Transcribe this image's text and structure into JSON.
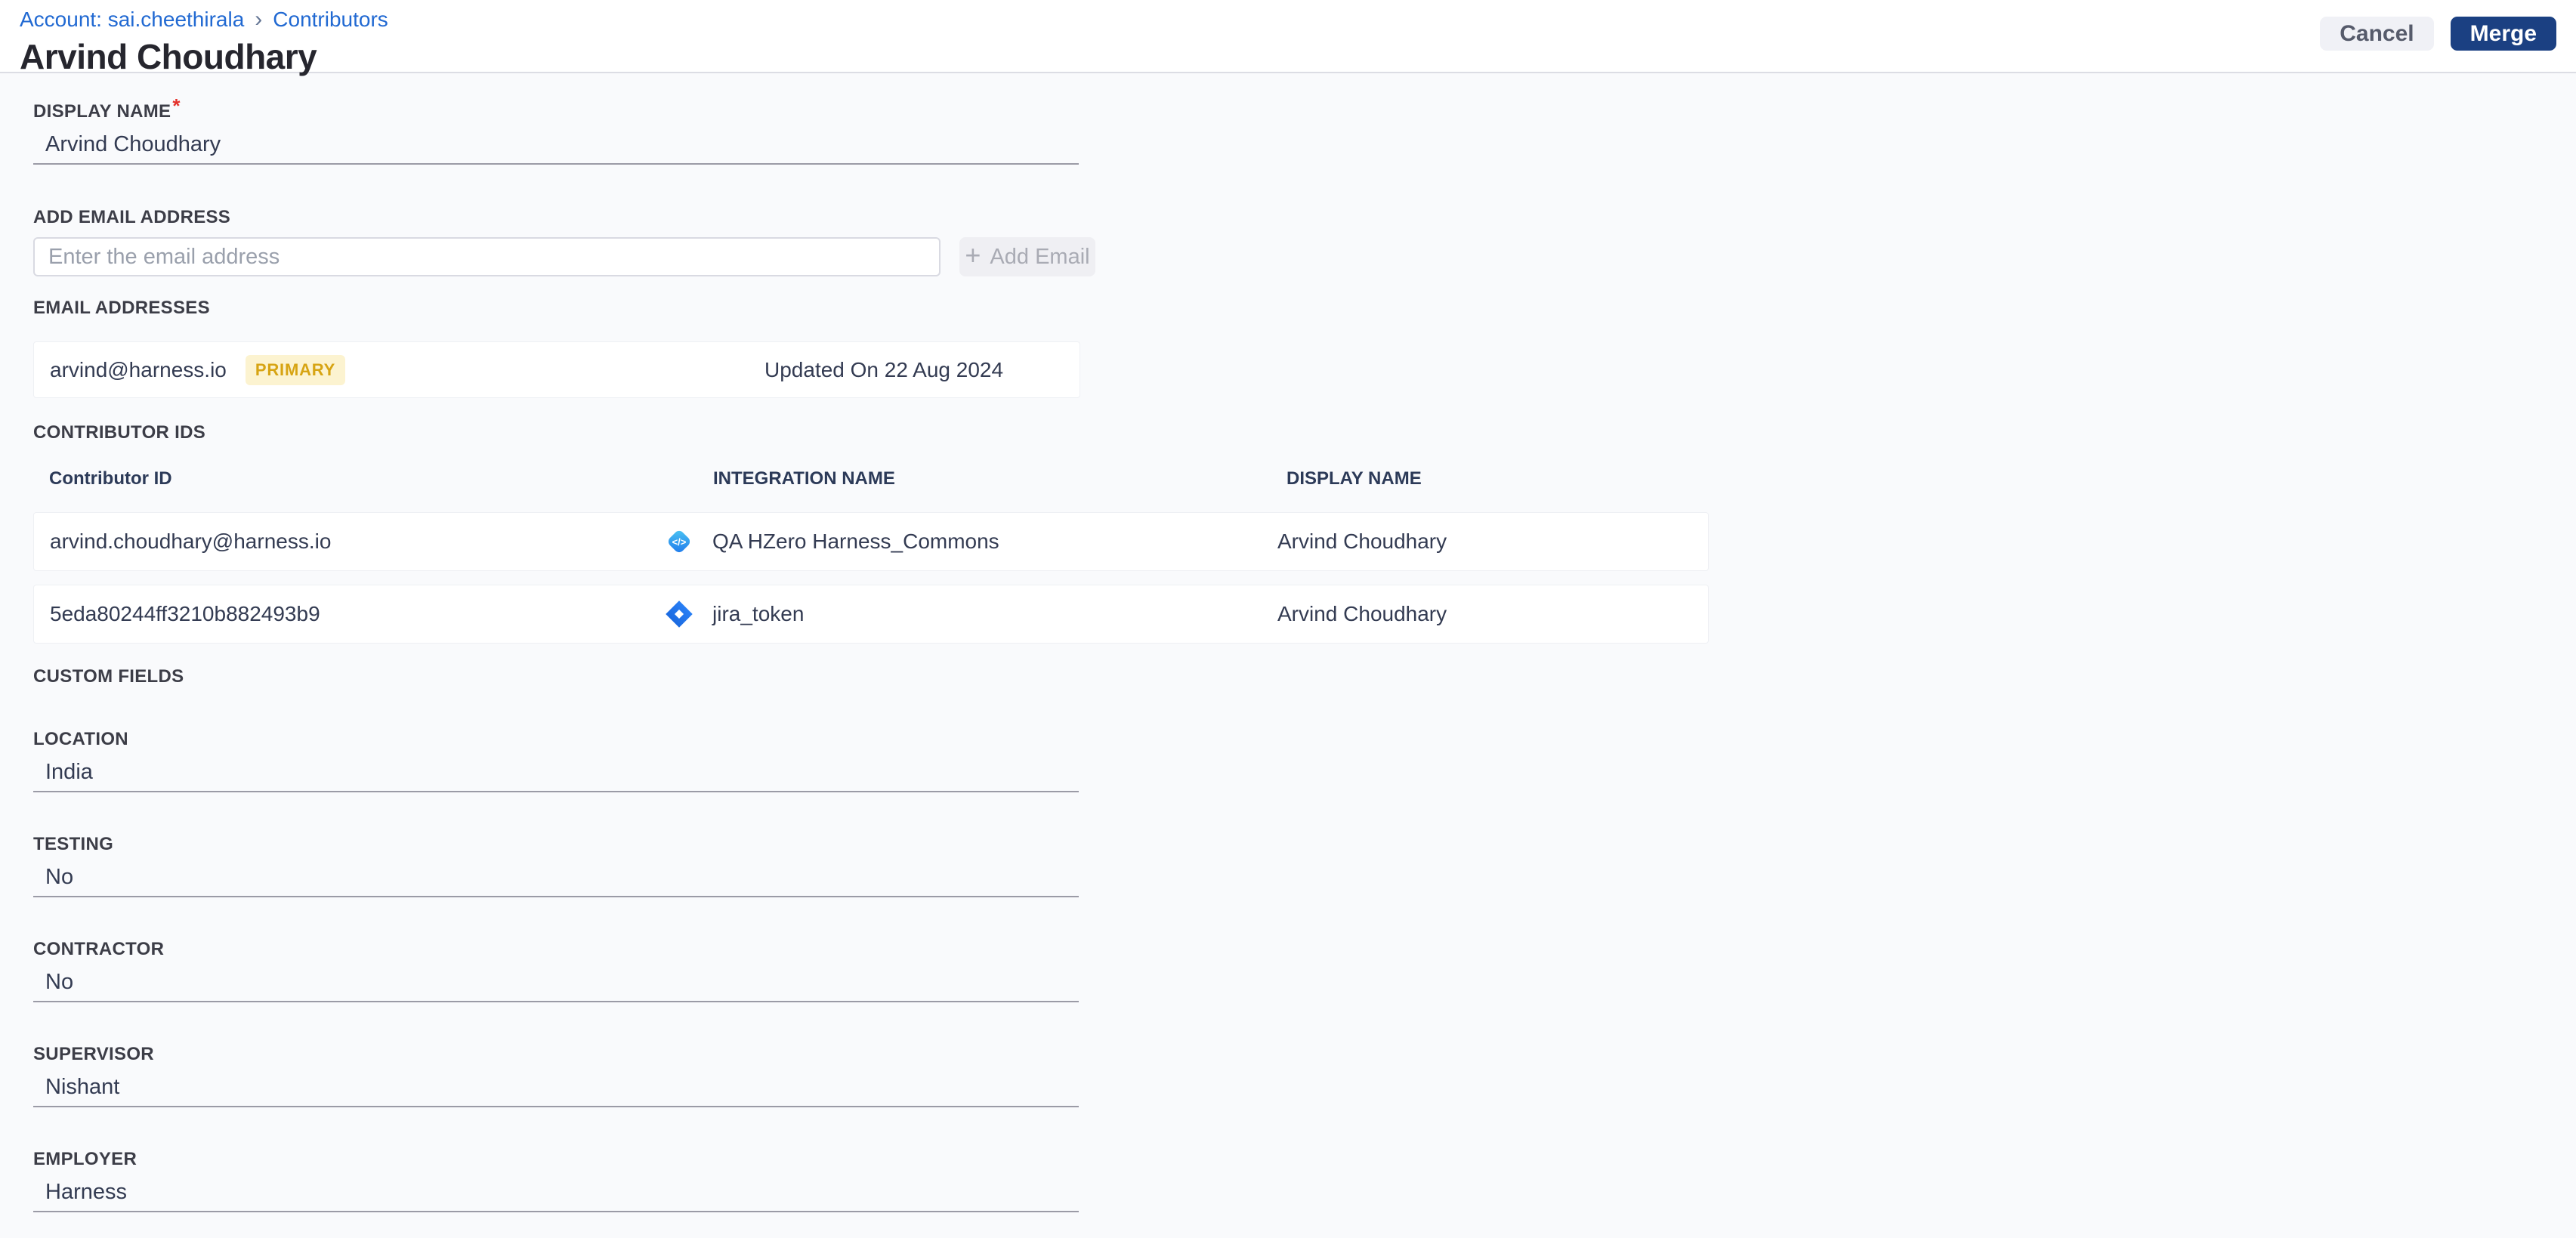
{
  "breadcrumb": {
    "account": "Account: sai.cheethirala",
    "separator": "›",
    "current": "Contributors"
  },
  "header": {
    "title": "Arvind Choudhary",
    "cancel_label": "Cancel",
    "merge_label": "Merge"
  },
  "display_name": {
    "label": "DISPLAY NAME",
    "required": "*",
    "value": "Arvind Choudhary"
  },
  "add_email": {
    "label": "ADD EMAIL ADDRESS",
    "placeholder": "Enter the email address",
    "plus": "+",
    "button_label": "Add Email"
  },
  "email_addresses": {
    "label": "EMAIL ADDRESSES",
    "items": [
      {
        "email": "arvind@harness.io",
        "badge": "PRIMARY",
        "updated": "Updated On 22 Aug 2024"
      }
    ]
  },
  "contributor_ids": {
    "label": "CONTRIBUTOR IDS",
    "columns": [
      "Contributor ID",
      "INTEGRATION NAME",
      "DISPLAY NAME"
    ],
    "rows": [
      {
        "id": "arvind.choudhary@harness.io",
        "icon": "code-integration-icon",
        "integration": "QA HZero Harness_Commons",
        "display_name": "Arvind Choudhary"
      },
      {
        "id": "5eda80244ff3210b882493b9",
        "icon": "jira-icon",
        "integration": "jira_token",
        "display_name": "Arvind Choudhary"
      }
    ]
  },
  "custom_fields": {
    "label": "CUSTOM FIELDS",
    "fields": [
      {
        "label": "LOCATION",
        "value": "India"
      },
      {
        "label": "TESTING",
        "value": "No"
      },
      {
        "label": "CONTRACTOR",
        "value": "No"
      },
      {
        "label": "SUPERVISOR",
        "value": "Nishant"
      },
      {
        "label": "EMPLOYER",
        "value": "Harness"
      }
    ]
  },
  "icons": {
    "code_glyph": "</>"
  },
  "colors": {
    "merge_button": "#1b4082",
    "cancel_button_bg": "#f0f1f6",
    "link_blue": "#2169d2",
    "badge_bg": "#fcf3d0",
    "badge_text": "#d7a413",
    "page_bg": "#f9fafc",
    "value_text": "#333b52",
    "required_red": "#e4312b"
  }
}
